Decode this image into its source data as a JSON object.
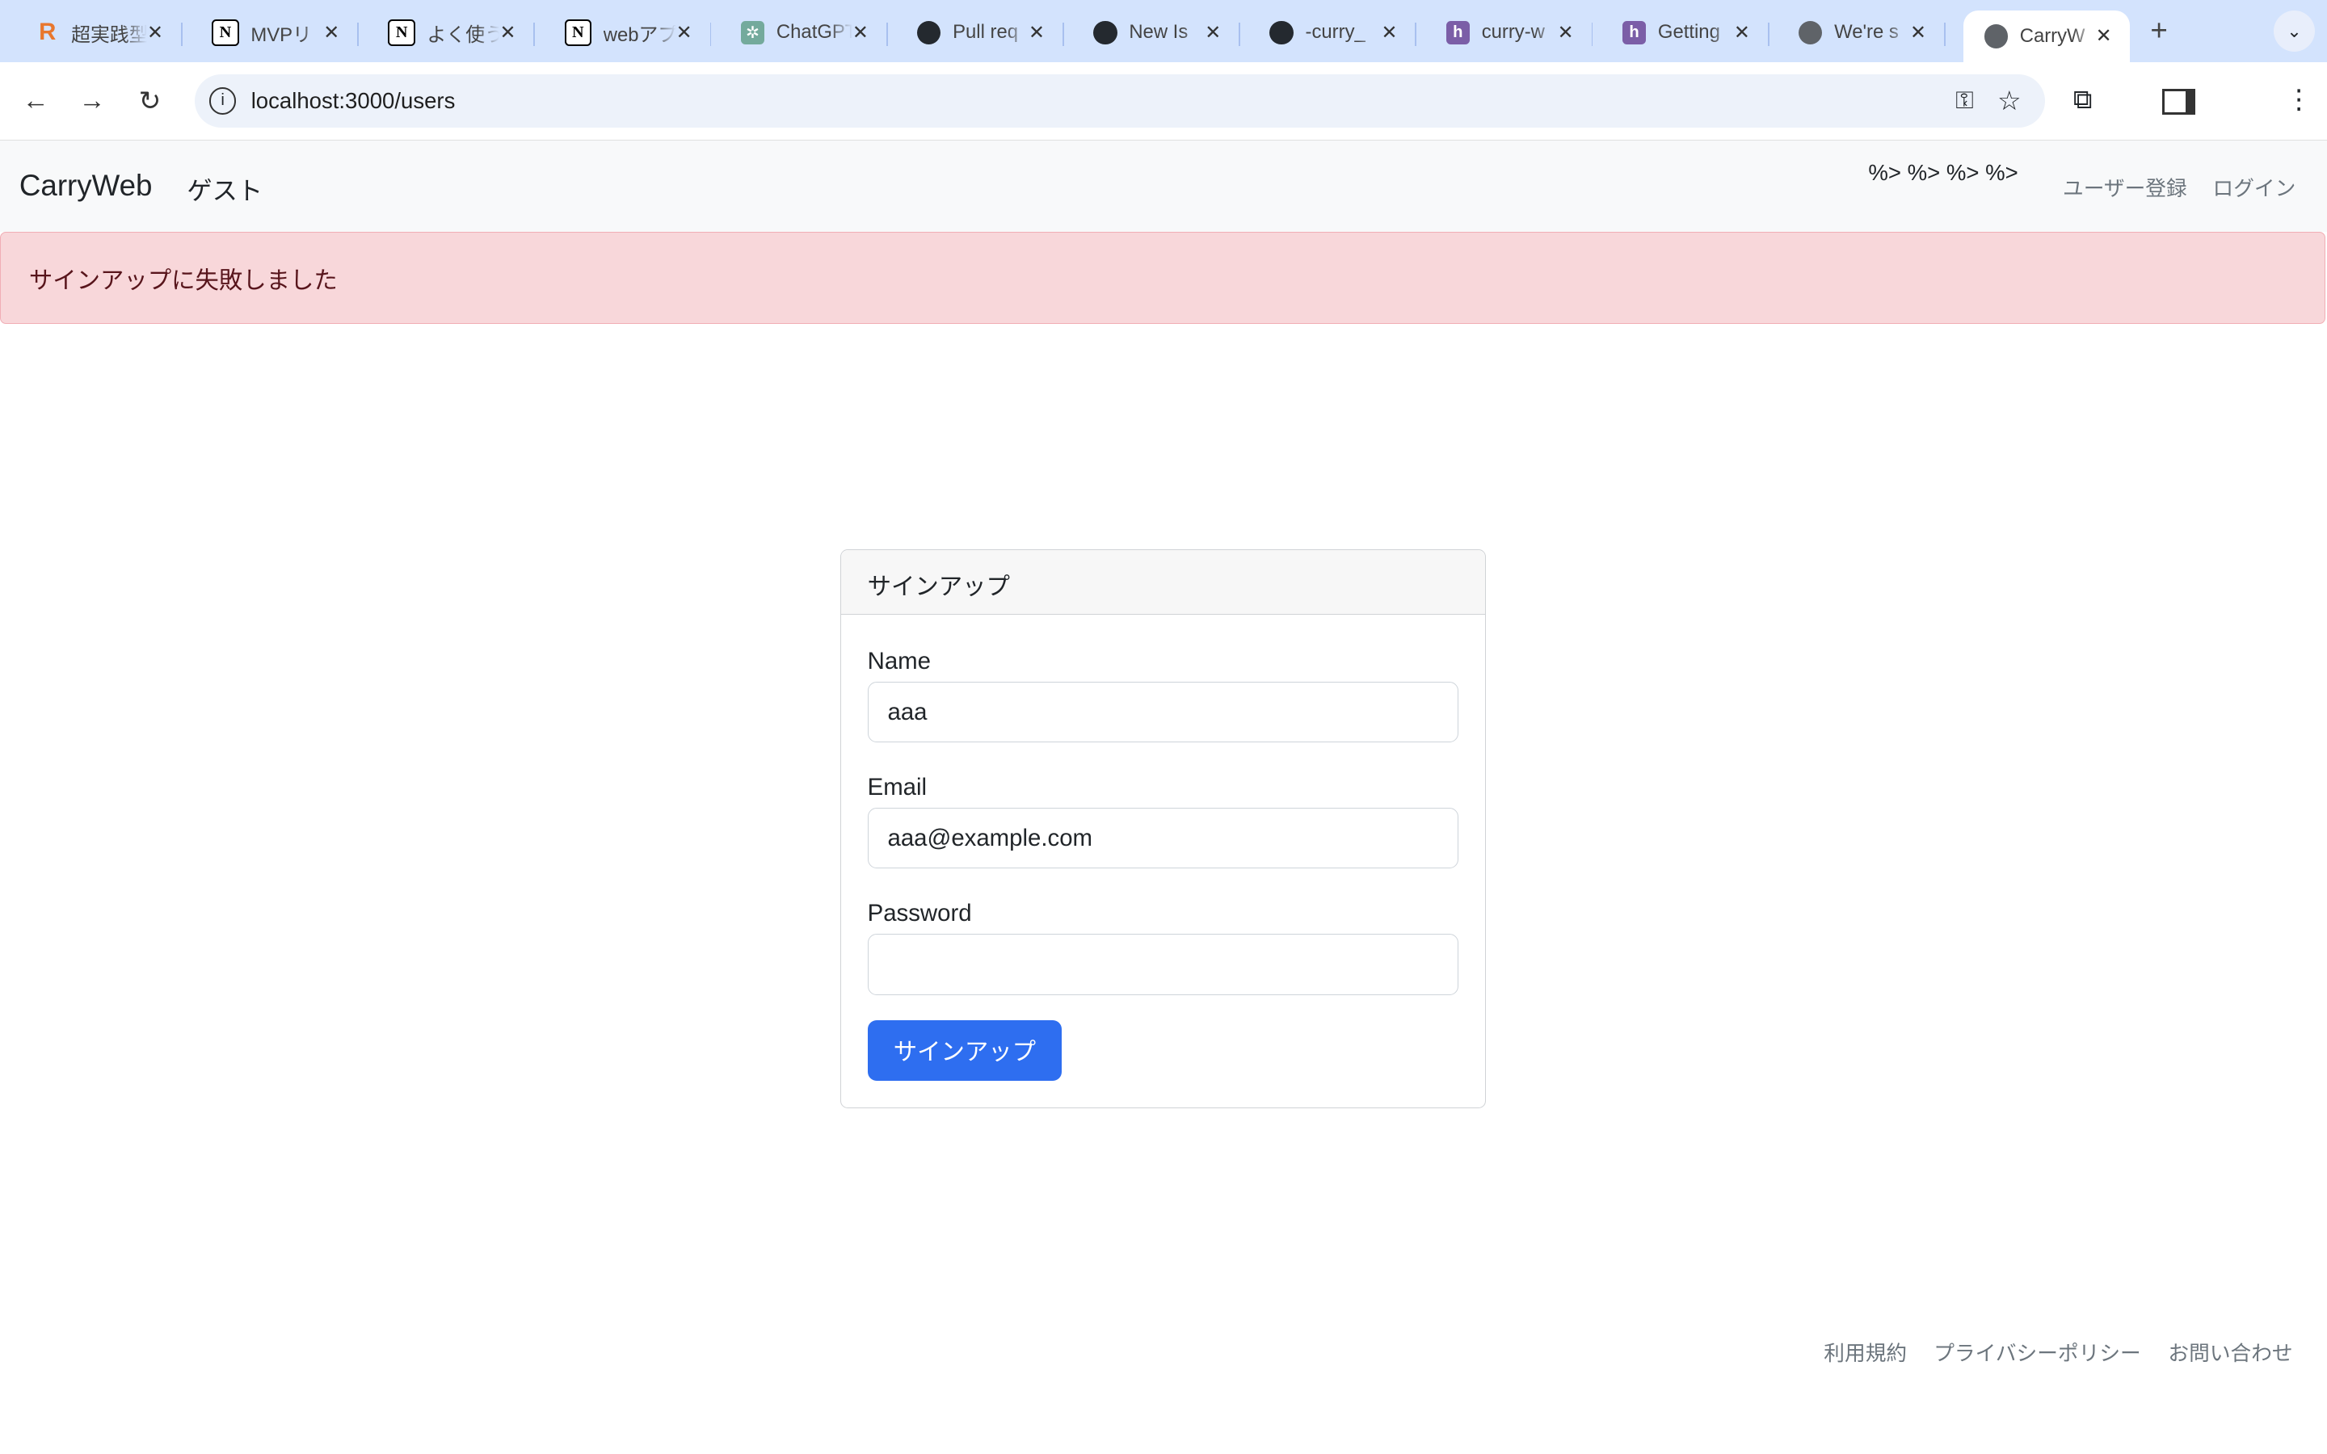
{
  "browser": {
    "tabs": [
      {
        "title": "超実践型",
        "icon": "r-logo-icon"
      },
      {
        "title": "MVPリ",
        "icon": "notion-icon"
      },
      {
        "title": "よく使う",
        "icon": "notion-icon"
      },
      {
        "title": "webアプ",
        "icon": "notion-icon"
      },
      {
        "title": "ChatGPT",
        "icon": "chatgpt-icon"
      },
      {
        "title": "Pull req",
        "icon": "github-icon"
      },
      {
        "title": "New Is",
        "icon": "github-icon"
      },
      {
        "title": "-curry_",
        "icon": "github-icon"
      },
      {
        "title": "curry-w",
        "icon": "heroku-icon"
      },
      {
        "title": "Getting",
        "icon": "heroku-icon"
      },
      {
        "title": "We're s",
        "icon": "globe-icon"
      },
      {
        "title": "CarryW",
        "icon": "globe-icon",
        "active": true
      }
    ],
    "url": "localhost:3000/users"
  },
  "navbar": {
    "brand": "CarryWeb",
    "user": "ゲスト",
    "stray": "%> %> %> %>",
    "links": [
      "ユーザー登録",
      "ログイン"
    ]
  },
  "alert": {
    "message": "サインアップに失敗しました",
    "color": "#f8d7da"
  },
  "form": {
    "title": "サインアップ",
    "name_label": "Name",
    "name_value": "aaa",
    "email_label": "Email",
    "email_value": "aaa@example.com",
    "password_label": "Password",
    "password_value": "",
    "submit": "サインアップ",
    "accent": "#2e6ef0"
  },
  "footer": {
    "links": [
      "利用規約",
      "プライバシーポリシー",
      "お問い合わせ"
    ]
  }
}
